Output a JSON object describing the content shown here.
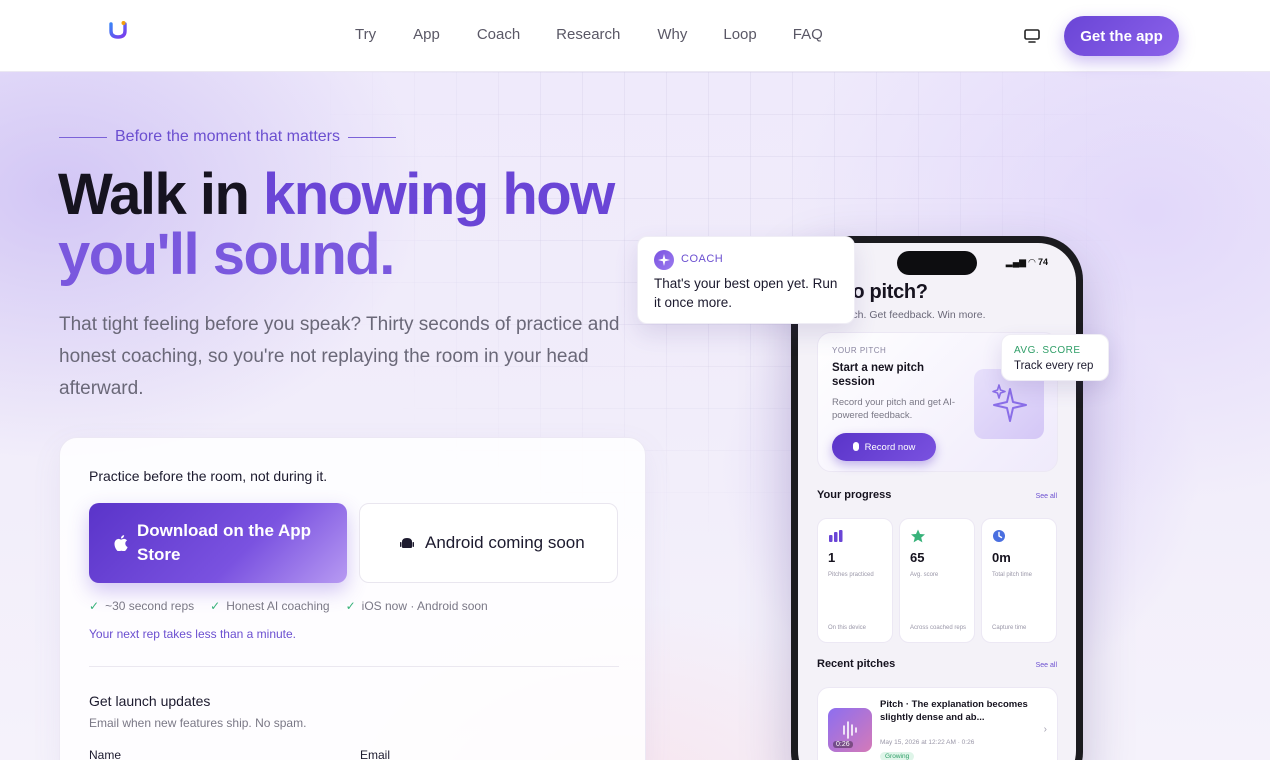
{
  "nav": {
    "links": [
      "Try",
      "App",
      "Coach",
      "Research",
      "Why",
      "Loop",
      "FAQ"
    ],
    "cta": "Get the app",
    "theme_icon": "monitor-icon",
    "logo_icon": "u-logo-icon"
  },
  "hero": {
    "eyebrow": "Before the moment that matters",
    "headline_plain": "Walk in ",
    "headline_accent_1": "knowing how",
    "headline_accent_2": "you'll sound.",
    "subtitle": "That tight feeling before you speak? Thirty seconds of practice and honest coaching, so you're not replaying the room in your head afterward."
  },
  "card": {
    "title": "Practice before the room, not during it.",
    "ios_button": "Download on the App Store",
    "android_button": "Android coming soon",
    "checks": [
      "~30 second reps",
      "Honest AI coaching",
      "iOS now · Android soon"
    ],
    "next_rep": "Your next rep takes less than a minute.",
    "launch_title": "Get launch updates",
    "launch_sub": "Email when new features ship. No spam.",
    "name_label": "Name",
    "email_label": "Email"
  },
  "coach_bubble": {
    "label": "COACH",
    "text": "That's your best open yet. Run it once more."
  },
  "avg_bubble": {
    "label": "AVG. SCORE",
    "text": "Track every rep"
  },
  "phone": {
    "status_battery": "74",
    "title": "dy to pitch?",
    "subtitle": "your pitch. Get feedback. Win more.",
    "pitch_card": {
      "label": "YOUR PITCH",
      "title": "Start a new pitch session",
      "desc": "Record your pitch and get AI-powered feedback.",
      "button": "Record now"
    },
    "progress": {
      "title": "Your progress",
      "see_all": "See all",
      "stats": [
        {
          "value": "1",
          "caption": "Pitches practiced",
          "foot": "On this device",
          "icon": "bar-chart-icon"
        },
        {
          "value": "65",
          "caption": "Avg. score",
          "foot": "Across coached reps",
          "icon": "star-icon"
        },
        {
          "value": "0m",
          "caption": "Total pitch time",
          "foot": "Capture time",
          "icon": "clock-icon"
        }
      ]
    },
    "recent": {
      "title": "Recent pitches",
      "see_all": "See all",
      "item": {
        "title": "Pitch · The explanation becomes slightly dense and ab...",
        "meta": "May 15, 2026 at 12:22 AM · 0:26",
        "duration": "0:26",
        "tag": "Growing"
      }
    }
  },
  "colors": {
    "accent": "#6a45d6",
    "accent_light": "#7a58de",
    "success": "#38b27a"
  }
}
